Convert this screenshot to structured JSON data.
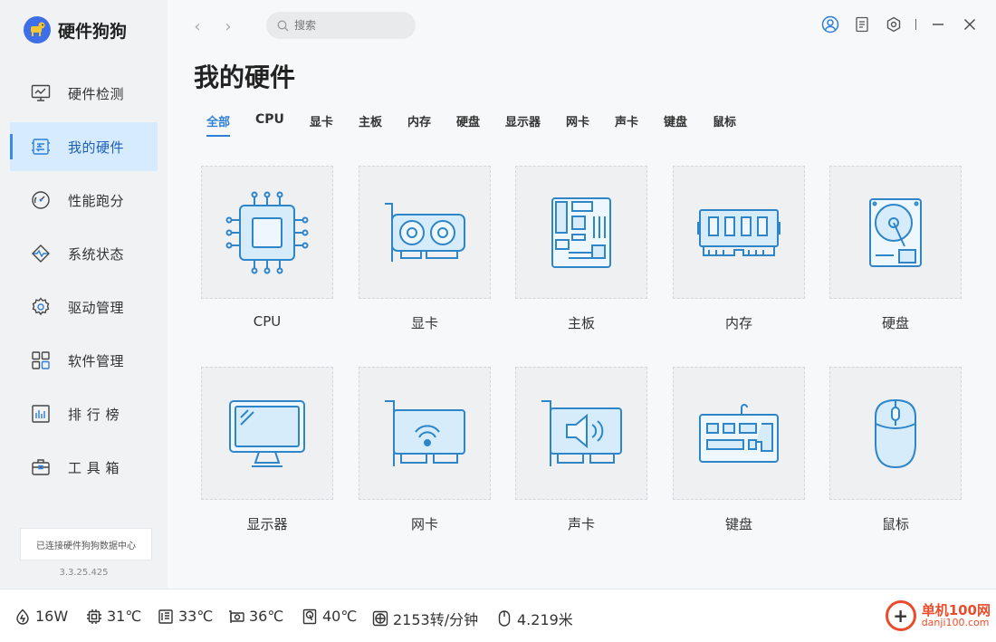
{
  "app": {
    "title": "硬件狗狗"
  },
  "sidebar": {
    "items": [
      {
        "label": "硬件检测",
        "icon": "monitor-chart-icon"
      },
      {
        "label": "我的硬件",
        "icon": "hardware-board-icon"
      },
      {
        "label": "性能跑分",
        "icon": "gauge-icon"
      },
      {
        "label": "系统状态",
        "icon": "heartbeat-icon"
      },
      {
        "label": "驱动管理",
        "icon": "gear-icon"
      },
      {
        "label": "软件管理",
        "icon": "apps-grid-icon"
      },
      {
        "label": "排 行 榜",
        "icon": "bar-chart-icon"
      },
      {
        "label": "工 具 箱",
        "icon": "toolbox-icon"
      }
    ],
    "active_index": 1,
    "status": "已连接硬件狗狗数据中心",
    "version": "3.3.25.425"
  },
  "topbar": {
    "search_placeholder": "搜索"
  },
  "main": {
    "title": "我的硬件",
    "tabs": [
      "全部",
      "CPU",
      "显卡",
      "主板",
      "内存",
      "硬盘",
      "显示器",
      "网卡",
      "声卡",
      "键盘",
      "鼠标"
    ],
    "active_tab": 0,
    "cards": [
      {
        "label": "CPU",
        "icon": "cpu-icon"
      },
      {
        "label": "显卡",
        "icon": "graphics-card-icon"
      },
      {
        "label": "主板",
        "icon": "motherboard-icon"
      },
      {
        "label": "内存",
        "icon": "ram-icon"
      },
      {
        "label": "硬盘",
        "icon": "hard-disk-icon"
      },
      {
        "label": "显示器",
        "icon": "monitor-icon"
      },
      {
        "label": "网卡",
        "icon": "network-card-icon"
      },
      {
        "label": "声卡",
        "icon": "sound-card-icon"
      },
      {
        "label": "键盘",
        "icon": "keyboard-icon"
      },
      {
        "label": "鼠标",
        "icon": "mouse-icon"
      }
    ]
  },
  "footer": {
    "power": "16W",
    "cpu_temp": "31℃",
    "board_temp": "33℃",
    "gpu_temp": "36℃",
    "disk_temp": "40℃",
    "fan_speed": "2153转/分钟",
    "mouse_distance": "4.219米",
    "watermark_cn": "单机100网",
    "watermark_url": "danji100.com"
  },
  "colors": {
    "accent": "#2f7fd8",
    "icon_stroke": "#2e86c9",
    "icon_fill": "#d7ecfb",
    "active_bg": "#d6ebfd"
  }
}
